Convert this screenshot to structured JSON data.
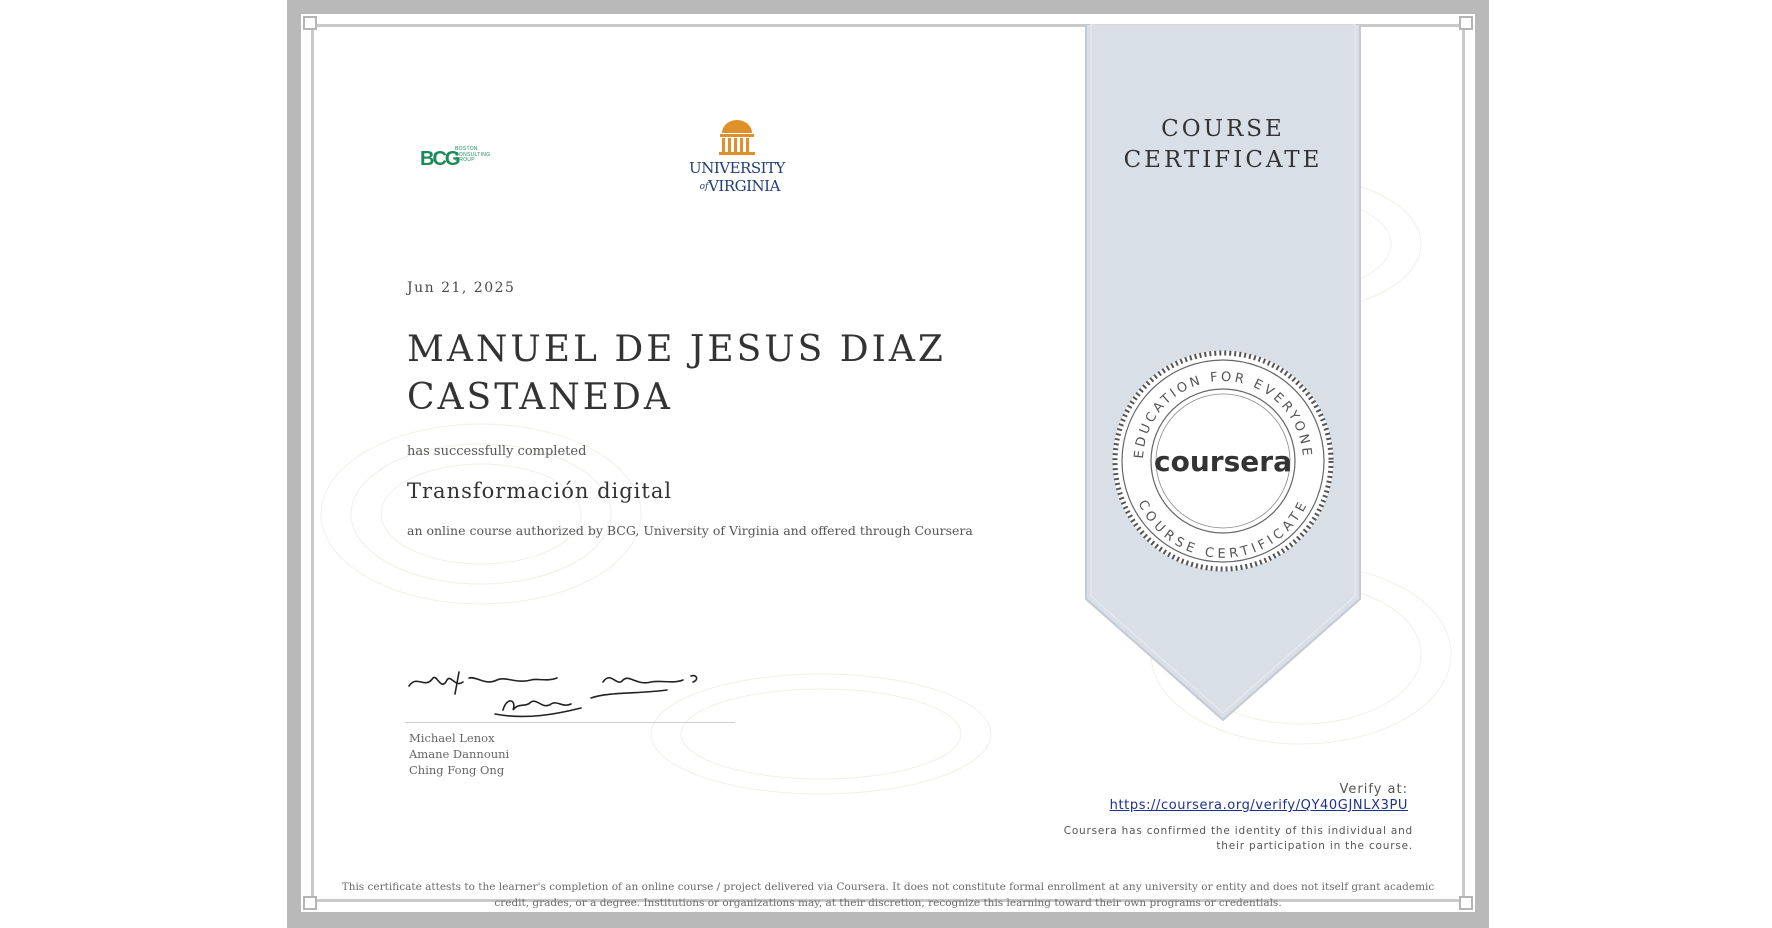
{
  "certificate": {
    "ribbon_line1": "COURSE",
    "ribbon_line2": "CERTIFICATE",
    "date": "Jun 21, 2025",
    "recipient_line1": "MANUEL DE JESUS DIAZ",
    "recipient_line2": "CASTANEDA",
    "completed_text": "has successfully completed",
    "course_title": "Transformación digital",
    "authorized_text": "an online course authorized by BCG, University of Virginia and offered through Coursera",
    "signers": [
      "Michael Lenox",
      "Amane Dannouni",
      "Ching Fong Ong"
    ],
    "verify_label": "Verify at:",
    "verify_url": "https://coursera.org/verify/QY40GJNLX3PU",
    "identity_text": "Coursera has confirmed the identity of this individual and their participation in the course.",
    "disclaimer": "This certificate attests to the learner's completion of an online course / project delivered via Coursera. It does not constitute formal enrollment at any university or entity and does not itself grant academic credit, grades, or a degree. Institutions or organizations may, at their discretion, recognize this learning toward their own programs or credentials."
  },
  "logos": {
    "bcg_mark": "BCG",
    "bcg_sub1": "BOSTON",
    "bcg_sub2": "CONSULTING",
    "bcg_sub3": "GROUP",
    "uva_line1": "UNIVERSITY",
    "uva_of": "of",
    "uva_line2": "VIRGINIA"
  },
  "seal": {
    "top_arc": "EDUCATION FOR EVERYONE",
    "bottom_arc": "COURSE CERTIFICATE",
    "brand": "coursera"
  },
  "colors": {
    "bcg_green": "#1b8a5a",
    "uva_orange": "#e0902a",
    "uva_blue": "#1f3f7a",
    "ribbon": "#d9dfe7",
    "link": "#1f2f8f"
  }
}
